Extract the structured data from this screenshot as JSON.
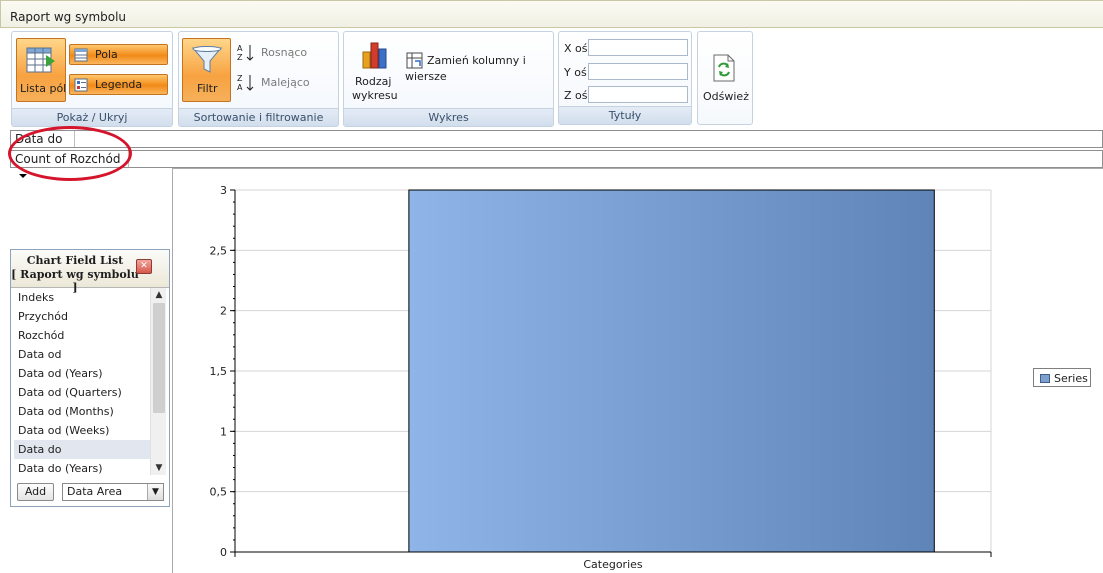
{
  "window": {
    "title": "Raport wg symbolu"
  },
  "ribbon": {
    "show_hide": {
      "label": "Pokaż / Ukryj",
      "field_list_button": "Lista pól",
      "fields_button": "Pola",
      "legend_button": "Legenda"
    },
    "sort_filter": {
      "label": "Sortowanie i filtrowanie",
      "filter_button": "Filtr",
      "ascending_button": "Rosnąco",
      "descending_button": "Malejąco"
    },
    "chart": {
      "label": "Wykres",
      "chart_type_line1": "Rodzaj",
      "chart_type_line2": "wykresu",
      "swap_line1": "Zamień kolumny i",
      "swap_line2": "wiersze"
    },
    "titles": {
      "label": "Tytuły",
      "x_axis": "X oś",
      "y_axis": "Y oś",
      "z_axis": "Z oś",
      "x_value": "",
      "y_value": "",
      "z_value": ""
    },
    "refresh": {
      "label": "Odśwież"
    }
  },
  "filter_row": {
    "field": "Data do"
  },
  "data_row": {
    "field": "Count of Rozchód"
  },
  "field_list": {
    "title_line1": "Chart Field List",
    "title_line2": "[ Raport wg symbolu ]",
    "items": [
      "Indeks",
      "Przychód",
      "Rozchód",
      "Data od",
      "Data od (Years)",
      "Data od (Quarters)",
      "Data od (Months)",
      "Data od (Weeks)",
      "Data do",
      "Data do (Years)"
    ],
    "selected_item": "Data do",
    "add_button": "Add",
    "area_value": "Data Area"
  },
  "colors": {
    "accent_orange": "#f7a241",
    "bar_light": "#8fb5e8",
    "bar_dark": "#5f84b8",
    "annotation_red": "#d4152c"
  },
  "chart_data": {
    "type": "bar",
    "categories": [
      "Categories"
    ],
    "series": [
      {
        "name": "Series",
        "values": [
          3
        ]
      }
    ],
    "ylim": [
      0,
      3
    ],
    "yticks": [
      "0",
      "0,5",
      "1",
      "1,5",
      "2",
      "2,5",
      "3"
    ],
    "ytick_values": [
      0,
      0.5,
      1,
      1.5,
      2,
      2.5,
      3
    ],
    "grid": true,
    "legend": "right"
  }
}
